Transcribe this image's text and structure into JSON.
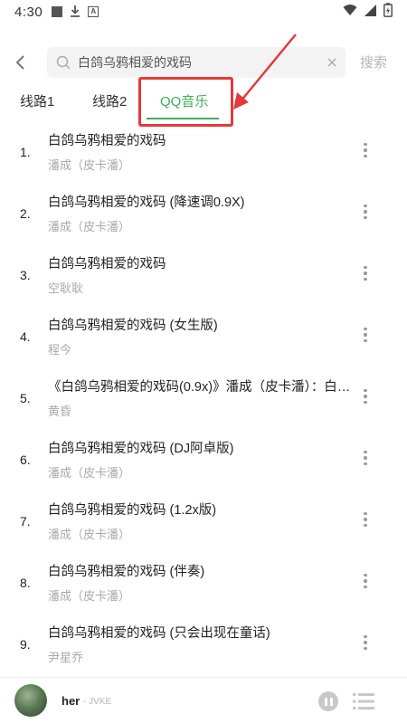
{
  "status_bar": {
    "time": "4:30",
    "icons": [
      "square-notification-icon",
      "download-icon",
      "a-notification-icon",
      "wifi-icon",
      "signal-icon",
      "battery-charging-icon"
    ]
  },
  "search": {
    "query": "白鸽乌鸦相爱的戏码",
    "submit_label": "搜索"
  },
  "tabs": [
    {
      "label": "线路1",
      "active": false
    },
    {
      "label": "线路2",
      "active": false
    },
    {
      "label": "QQ音乐",
      "active": true
    }
  ],
  "colors": {
    "accent": "#3fae5a",
    "annotation": "#e23a3a",
    "secondary_text": "#a9a9a9"
  },
  "songs": [
    {
      "index": "1.",
      "title": "白鸽乌鸦相爱的戏码",
      "artist": "潘成（皮卡潘）"
    },
    {
      "index": "2.",
      "title": "白鸽乌鸦相爱的戏码 (降速调0.9X)",
      "artist": "潘成（皮卡潘）"
    },
    {
      "index": "3.",
      "title": "白鸽乌鸦相爱的戏码",
      "artist": "空耿耿"
    },
    {
      "index": "4.",
      "title": "白鸽乌鸦相爱的戏码 (女生版)",
      "artist": "程今"
    },
    {
      "index": "5.",
      "title": "《白鸽乌鸦相爱的戏码(0.9x)》潘成（皮卡潘）：白鸽...",
      "artist": "黄昏"
    },
    {
      "index": "6.",
      "title": "白鸽乌鸦相爱的戏码 (DJ阿卓版)",
      "artist": "潘成（皮卡潘）"
    },
    {
      "index": "7.",
      "title": "白鸽乌鸦相爱的戏码 (1.2x版)",
      "artist": "潘成（皮卡潘）"
    },
    {
      "index": "8.",
      "title": "白鸽乌鸦相爱的戏码 (伴奏)",
      "artist": "潘成（皮卡潘）"
    },
    {
      "index": "9.",
      "title": "白鸽乌鸦相爱的戏码 (只会出现在童话)",
      "artist": "尹星乔"
    }
  ],
  "player": {
    "track": "her",
    "artist": "- JVKE"
  }
}
